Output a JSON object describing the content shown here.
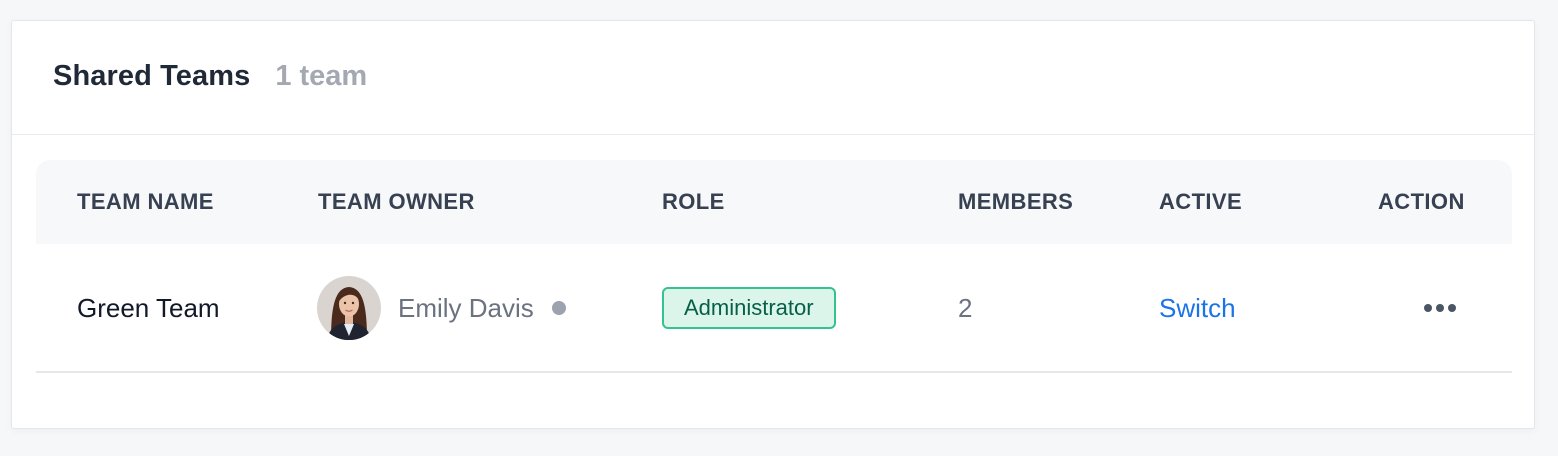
{
  "header": {
    "title": "Shared Teams",
    "count": "1 team"
  },
  "table": {
    "columns": {
      "team_name": "TEAM NAME",
      "team_owner": "TEAM OWNER",
      "role": "ROLE",
      "members": "MEMBERS",
      "active": "ACTIVE",
      "action": "ACTION"
    },
    "rows": [
      {
        "team_name": "Green Team",
        "owner_name": "Emily Davis",
        "owner_status": "offline",
        "role": "Administrator",
        "members": "2",
        "active": "Switch",
        "action_icon": "more-horizontal-icon"
      }
    ]
  },
  "colors": {
    "title": "#1f2937",
    "muted": "#a3a8b1",
    "link": "#1a73e8",
    "badge_bg": "#dcf5eb",
    "badge_border": "#34c38f",
    "badge_text": "#065f46",
    "status_offline": "#9ca3af"
  }
}
